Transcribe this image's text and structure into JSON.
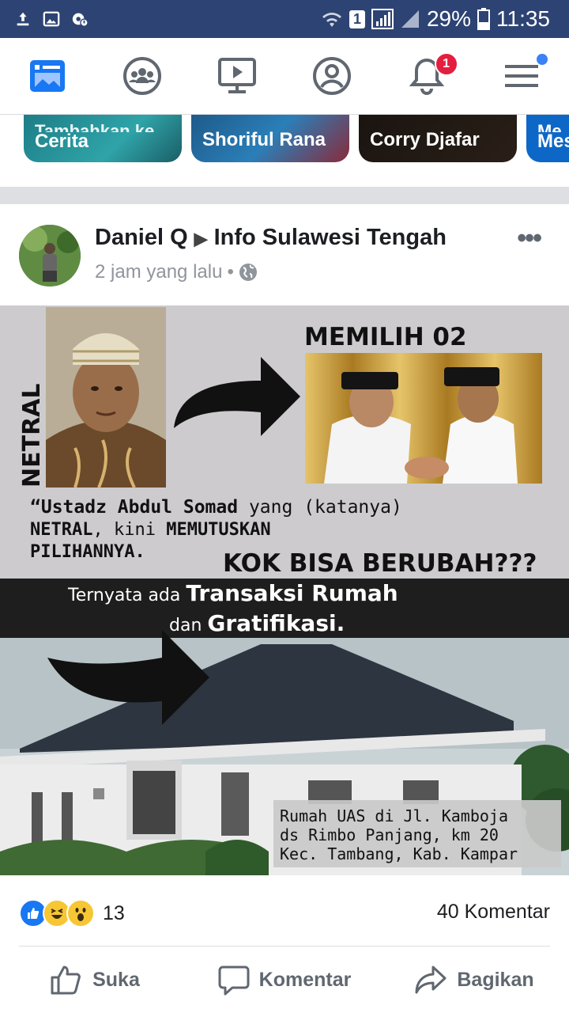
{
  "status_bar": {
    "battery": "29%",
    "time": "11:35",
    "sim": "1",
    "icons_left": [
      "download-icon",
      "image-icon",
      "settings-notification-icon"
    ],
    "icons_right": [
      "wifi-icon",
      "sim-icon",
      "signal-icon",
      "battery-icon"
    ]
  },
  "nav": {
    "items": [
      {
        "name": "news-feed",
        "icon": "news-feed-icon"
      },
      {
        "name": "groups",
        "icon": "groups-icon"
      },
      {
        "name": "watch",
        "icon": "watch-icon"
      },
      {
        "name": "profile",
        "icon": "profile-icon"
      },
      {
        "name": "notifications",
        "icon": "bell-icon"
      },
      {
        "name": "menu",
        "icon": "menu-icon"
      }
    ],
    "notification_count": "1"
  },
  "stories": [
    {
      "line1": "Tambahkan ke",
      "line2": "Cerita"
    },
    {
      "label": "Shoriful Rana"
    },
    {
      "label": "Corry Djafar"
    },
    {
      "line1": "Me",
      "line2": "Mes"
    }
  ],
  "post": {
    "author": "Daniel Q",
    "target": "Info Sulawesi Tengah",
    "time": "2 jam yang lalu",
    "time_sep": "•",
    "more": "•••"
  },
  "image_text": {
    "netral": "NETRAL",
    "memilih": "MEMILIH 02",
    "quote_part1": "“Ustadz Abdul Somad",
    "quote_part2": " yang (katanya)",
    "quote_part3": "NETRAL",
    "quote_part4": ", kini ",
    "quote_part5": "MEMUTUSKAN",
    "quote_part6": "PILIHANNYA.",
    "kok": "KOK BISA BERUBAH???",
    "ternyata": "Ternyata ada ",
    "transaksi": "Transaksi Rumah",
    "dan": "dan ",
    "gratifikasi": "Gratifikasi.",
    "caption1": "Rumah UAS di Jl. Kamboja",
    "caption2": "ds Rimbo Panjang, km 20",
    "caption3": "Kec. Tambang, Kab. Kampar"
  },
  "reactions": {
    "count": "13",
    "comments": "40 Komentar",
    "types": [
      "like-icon",
      "haha-icon",
      "wow-icon"
    ]
  },
  "actions": {
    "like": "Suka",
    "comment": "Komentar",
    "share": "Bagikan"
  },
  "colors": {
    "status_bar": "#2d4373",
    "accent": "#1877f2",
    "badge": "#e41e3f"
  }
}
